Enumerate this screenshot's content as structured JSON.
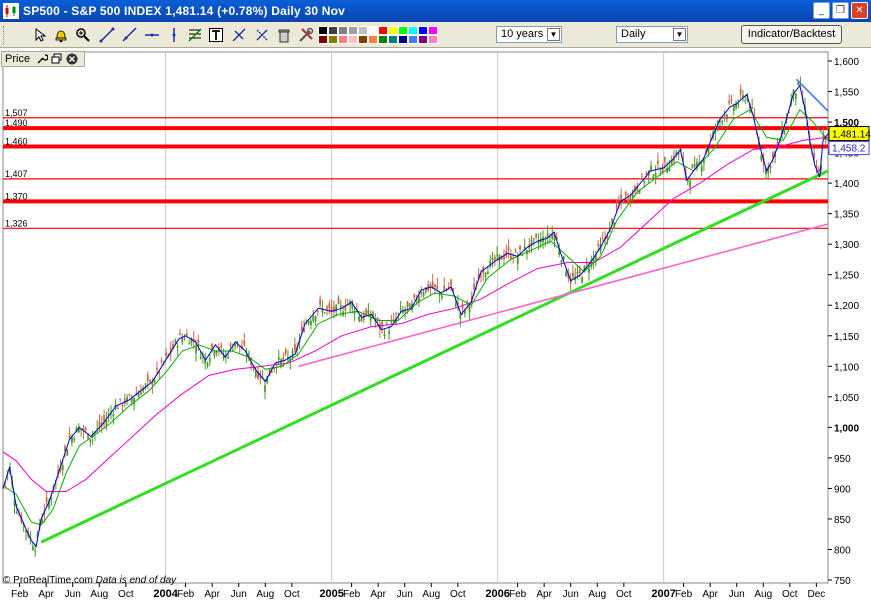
{
  "window": {
    "title": "SP500 - S&P 500 INDEX   1,481.14 (+0.78%)   Daily  30 Nov",
    "buttons": {
      "minimize": "_",
      "restore": "❐",
      "close": "✕"
    }
  },
  "toolbar": {
    "icons": [
      "cursor-icon",
      "alarm-bell-icon",
      "zoom-icon",
      "trendline-icon",
      "ray-icon",
      "horizontal-line-icon",
      "vertical-line-icon",
      "fibonacci-icon",
      "text-icon",
      "arrows-icon",
      "cross-arrows-icon",
      "trash-icon",
      "tools-icon"
    ],
    "palette": [
      "#000000",
      "#404040",
      "#808080",
      "#a0a0a0",
      "#c0c0c0",
      "#ffffff",
      "#ff0000",
      "#ffff00",
      "#00ff00",
      "#00ffff",
      "#0000ff",
      "#ff00ff",
      "#800000",
      "#808000",
      "#ff8080",
      "#ffc0c0",
      "#804000",
      "#ff8040",
      "#008000",
      "#008080",
      "#000080",
      "#4080ff",
      "#800080",
      "#ff80c0"
    ],
    "period_select": "10 years",
    "interval_select": "Daily",
    "indicator_button": "Indicator/Backtest"
  },
  "panel": {
    "label": "Price"
  },
  "footer": {
    "copyright": "© ProRealTime.com",
    "note": "Data is end of day"
  },
  "chart_data": {
    "type": "line",
    "title": "SP500 - S&P 500 INDEX",
    "ylim": [
      750,
      1610
    ],
    "y_ticks": [
      750,
      800,
      850,
      900,
      950,
      1000,
      1050,
      1100,
      1150,
      1200,
      1250,
      1300,
      1350,
      1400,
      1450,
      1500,
      1550,
      1600
    ],
    "y_tick_labels": [
      "750",
      "800",
      "850",
      "900",
      "950",
      "1,000",
      "1,050",
      "1,100",
      "1,150",
      "1,200",
      "1,250",
      "1,300",
      "1,350",
      "1,400",
      "1,450",
      "1,500",
      "1,550",
      "1,600"
    ],
    "x_year_labels": [
      {
        "label": "2004",
        "t": 2004.0
      },
      {
        "label": "2005",
        "t": 2005.0
      },
      {
        "label": "2006",
        "t": 2006.0
      },
      {
        "label": "2007",
        "t": 2007.0
      }
    ],
    "x_month_labels": [
      {
        "label": "Feb",
        "t": 2003.12
      },
      {
        "label": "Apr",
        "t": 2003.28
      },
      {
        "label": "Jun",
        "t": 2003.44
      },
      {
        "label": "Aug",
        "t": 2003.6
      },
      {
        "label": "Oct",
        "t": 2003.76
      },
      {
        "label": "Feb",
        "t": 2004.12
      },
      {
        "label": "Apr",
        "t": 2004.28
      },
      {
        "label": "Jun",
        "t": 2004.44
      },
      {
        "label": "Aug",
        "t": 2004.6
      },
      {
        "label": "Oct",
        "t": 2004.76
      },
      {
        "label": "Feb",
        "t": 2005.12
      },
      {
        "label": "Apr",
        "t": 2005.28
      },
      {
        "label": "Jun",
        "t": 2005.44
      },
      {
        "label": "Aug",
        "t": 2005.6
      },
      {
        "label": "Oct",
        "t": 2005.76
      },
      {
        "label": "Feb",
        "t": 2006.12
      },
      {
        "label": "Apr",
        "t": 2006.28
      },
      {
        "label": "Jun",
        "t": 2006.44
      },
      {
        "label": "Aug",
        "t": 2006.6
      },
      {
        "label": "Oct",
        "t": 2006.76
      },
      {
        "label": "Feb",
        "t": 2007.12
      },
      {
        "label": "Apr",
        "t": 2007.28
      },
      {
        "label": "Jun",
        "t": 2007.44
      },
      {
        "label": "Aug",
        "t": 2007.6
      },
      {
        "label": "Oct",
        "t": 2007.76
      },
      {
        "label": "Dec",
        "t": 2007.92
      }
    ],
    "xlim": [
      2003.02,
      2007.99
    ],
    "horizontal_levels": [
      {
        "label": "1,507",
        "value": 1507,
        "heavy": false
      },
      {
        "label": "1,490",
        "value": 1490,
        "heavy": true
      },
      {
        "label": "1,460",
        "value": 1460,
        "heavy": true
      },
      {
        "label": "1,407",
        "value": 1407,
        "heavy": false
      },
      {
        "label": "1,370",
        "value": 1370,
        "heavy": true
      },
      {
        "label": "1,326",
        "value": 1326,
        "heavy": false
      }
    ],
    "current_price": {
      "label": "1,481.14",
      "value": 1481.14
    },
    "ma_value": {
      "label": "1,458.2",
      "value": 1458.2
    },
    "trendlines": [
      {
        "name": "green-support",
        "color": "#33dd22",
        "x1": 2003.25,
        "y1": 812,
        "x2": 2007.99,
        "y2": 1420
      },
      {
        "name": "pink-support",
        "color": "#ff66cc",
        "x1": 2004.8,
        "y1": 1100,
        "x2": 2007.99,
        "y2": 1333
      },
      {
        "name": "blue-resistance",
        "color": "#4477ff",
        "x1": 2007.8,
        "y1": 1570,
        "x2": 2007.99,
        "y2": 1518
      }
    ],
    "price": [
      [
        2003.02,
        900
      ],
      [
        2003.06,
        935
      ],
      [
        2003.1,
        870
      ],
      [
        2003.14,
        845
      ],
      [
        2003.19,
        815
      ],
      [
        2003.22,
        805
      ],
      [
        2003.25,
        850
      ],
      [
        2003.3,
        880
      ],
      [
        2003.36,
        930
      ],
      [
        2003.42,
        980
      ],
      [
        2003.48,
        1000
      ],
      [
        2003.55,
        985
      ],
      [
        2003.62,
        1005
      ],
      [
        2003.7,
        1035
      ],
      [
        2003.78,
        1045
      ],
      [
        2003.85,
        1060
      ],
      [
        2003.92,
        1075
      ],
      [
        2004.0,
        1110
      ],
      [
        2004.08,
        1145
      ],
      [
        2004.12,
        1150
      ],
      [
        2004.18,
        1140
      ],
      [
        2004.24,
        1110
      ],
      [
        2004.3,
        1135
      ],
      [
        2004.36,
        1115
      ],
      [
        2004.42,
        1140
      ],
      [
        2004.48,
        1125
      ],
      [
        2004.54,
        1095
      ],
      [
        2004.6,
        1075
      ],
      [
        2004.66,
        1105
      ],
      [
        2004.72,
        1110
      ],
      [
        2004.78,
        1120
      ],
      [
        2004.84,
        1170
      ],
      [
        2004.92,
        1195
      ],
      [
        2005.0,
        1190
      ],
      [
        2005.06,
        1195
      ],
      [
        2005.12,
        1205
      ],
      [
        2005.18,
        1180
      ],
      [
        2005.24,
        1185
      ],
      [
        2005.3,
        1160
      ],
      [
        2005.36,
        1165
      ],
      [
        2005.42,
        1190
      ],
      [
        2005.48,
        1195
      ],
      [
        2005.54,
        1225
      ],
      [
        2005.6,
        1230
      ],
      [
        2005.66,
        1220
      ],
      [
        2005.72,
        1230
      ],
      [
        2005.78,
        1185
      ],
      [
        2005.84,
        1205
      ],
      [
        2005.9,
        1255
      ],
      [
        2006.0,
        1275
      ],
      [
        2006.06,
        1285
      ],
      [
        2006.12,
        1280
      ],
      [
        2006.18,
        1295
      ],
      [
        2006.24,
        1305
      ],
      [
        2006.3,
        1310
      ],
      [
        2006.34,
        1320
      ],
      [
        2006.38,
        1285
      ],
      [
        2006.44,
        1240
      ],
      [
        2006.5,
        1250
      ],
      [
        2006.56,
        1270
      ],
      [
        2006.62,
        1295
      ],
      [
        2006.68,
        1325
      ],
      [
        2006.74,
        1370
      ],
      [
        2006.8,
        1380
      ],
      [
        2006.86,
        1400
      ],
      [
        2006.92,
        1420
      ],
      [
        2007.0,
        1425
      ],
      [
        2007.06,
        1440
      ],
      [
        2007.1,
        1455
      ],
      [
        2007.14,
        1405
      ],
      [
        2007.18,
        1420
      ],
      [
        2007.24,
        1440
      ],
      [
        2007.3,
        1480
      ],
      [
        2007.34,
        1505
      ],
      [
        2007.4,
        1525
      ],
      [
        2007.44,
        1530
      ],
      [
        2007.5,
        1545
      ],
      [
        2007.54,
        1510
      ],
      [
        2007.58,
        1460
      ],
      [
        2007.62,
        1420
      ],
      [
        2007.66,
        1440
      ],
      [
        2007.7,
        1470
      ],
      [
        2007.74,
        1505
      ],
      [
        2007.78,
        1545
      ],
      [
        2007.82,
        1560
      ],
      [
        2007.86,
        1510
      ],
      [
        2007.88,
        1470
      ],
      [
        2007.91,
        1430
      ],
      [
        2007.94,
        1410
      ],
      [
        2007.96,
        1470
      ],
      [
        2007.99,
        1481
      ]
    ],
    "ma_short": [
      [
        2003.02,
        905
      ],
      [
        2003.1,
        890
      ],
      [
        2003.19,
        845
      ],
      [
        2003.25,
        840
      ],
      [
        2003.32,
        865
      ],
      [
        2003.4,
        925
      ],
      [
        2003.48,
        970
      ],
      [
        2003.56,
        985
      ],
      [
        2003.66,
        1005
      ],
      [
        2003.78,
        1035
      ],
      [
        2003.9,
        1060
      ],
      [
        2004.0,
        1090
      ],
      [
        2004.1,
        1125
      ],
      [
        2004.2,
        1135
      ],
      [
        2004.3,
        1125
      ],
      [
        2004.4,
        1125
      ],
      [
        2004.5,
        1115
      ],
      [
        2004.6,
        1095
      ],
      [
        2004.7,
        1100
      ],
      [
        2004.8,
        1120
      ],
      [
        2004.92,
        1170
      ],
      [
        2005.04,
        1185
      ],
      [
        2005.16,
        1190
      ],
      [
        2005.28,
        1175
      ],
      [
        2005.4,
        1175
      ],
      [
        2005.52,
        1205
      ],
      [
        2005.62,
        1220
      ],
      [
        2005.74,
        1215
      ],
      [
        2005.84,
        1200
      ],
      [
        2005.94,
        1245
      ],
      [
        2006.08,
        1275
      ],
      [
        2006.2,
        1290
      ],
      [
        2006.32,
        1305
      ],
      [
        2006.42,
        1280
      ],
      [
        2006.52,
        1255
      ],
      [
        2006.62,
        1280
      ],
      [
        2006.72,
        1340
      ],
      [
        2006.84,
        1385
      ],
      [
        2006.96,
        1410
      ],
      [
        2007.08,
        1435
      ],
      [
        2007.18,
        1420
      ],
      [
        2007.3,
        1455
      ],
      [
        2007.42,
        1505
      ],
      [
        2007.52,
        1520
      ],
      [
        2007.62,
        1475
      ],
      [
        2007.72,
        1470
      ],
      [
        2007.82,
        1520
      ],
      [
        2007.9,
        1500
      ],
      [
        2007.99,
        1470
      ]
    ],
    "ma_long": [
      [
        2003.02,
        960
      ],
      [
        2003.1,
        945
      ],
      [
        2003.19,
        915
      ],
      [
        2003.28,
        895
      ],
      [
        2003.4,
        895
      ],
      [
        2003.52,
        915
      ],
      [
        2003.66,
        950
      ],
      [
        2003.8,
        985
      ],
      [
        2003.94,
        1020
      ],
      [
        2004.1,
        1055
      ],
      [
        2004.26,
        1085
      ],
      [
        2004.42,
        1095
      ],
      [
        2004.58,
        1100
      ],
      [
        2004.74,
        1105
      ],
      [
        2004.9,
        1125
      ],
      [
        2005.06,
        1150
      ],
      [
        2005.24,
        1165
      ],
      [
        2005.42,
        1170
      ],
      [
        2005.58,
        1185
      ],
      [
        2005.74,
        1195
      ],
      [
        2005.9,
        1210
      ],
      [
        2006.06,
        1235
      ],
      [
        2006.24,
        1260
      ],
      [
        2006.42,
        1270
      ],
      [
        2006.58,
        1270
      ],
      [
        2006.74,
        1295
      ],
      [
        2006.9,
        1335
      ],
      [
        2007.06,
        1375
      ],
      [
        2007.22,
        1400
      ],
      [
        2007.38,
        1430
      ],
      [
        2007.54,
        1455
      ],
      [
        2007.7,
        1460
      ],
      [
        2007.84,
        1470
      ],
      [
        2007.99,
        1475
      ]
    ]
  }
}
